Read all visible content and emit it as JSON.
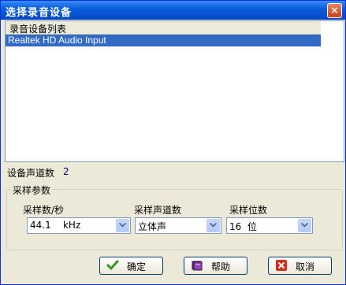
{
  "window": {
    "title": "选择录音设备",
    "close_glyph": "×"
  },
  "device_list": {
    "header": "录音设备列表",
    "items": [
      "Realtek HD Audio Input"
    ],
    "selected_color": "#316ac5"
  },
  "channels": {
    "label": "设备声道数",
    "value": "2"
  },
  "sampling": {
    "group_title": "采样参数",
    "rate": {
      "label": "采样数/秒",
      "value": "44.1    kHz"
    },
    "channels": {
      "label": "采样声道数",
      "value": "立体声"
    },
    "bits": {
      "label": "采样位数",
      "value": "16  位"
    }
  },
  "buttons": {
    "ok": {
      "label": "确定",
      "icon": "checkmark-icon"
    },
    "help": {
      "label": "帮助",
      "icon": "book-icon"
    },
    "cancel": {
      "label": "取消",
      "icon": "cancel-x-icon"
    }
  }
}
